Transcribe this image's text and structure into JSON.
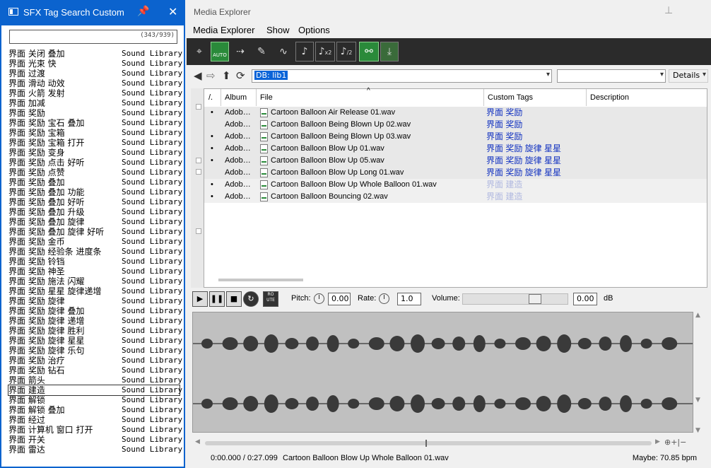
{
  "sfx_window": {
    "title": "SFX Tag Search Custom",
    "pin_glyph": "📌",
    "close_glyph": "✕",
    "count": "(343/939)",
    "rows": [
      {
        "tag": "界面 关闭 叠加",
        "lib": "Sound Library"
      },
      {
        "tag": "界面 光束 快",
        "lib": "Sound Library"
      },
      {
        "tag": "界面 过渡",
        "lib": "Sound Library"
      },
      {
        "tag": "界面 滑动 动效",
        "lib": "Sound Library"
      },
      {
        "tag": "界面 火箭 发射",
        "lib": "Sound Library"
      },
      {
        "tag": "界面 加减",
        "lib": "Sound Library"
      },
      {
        "tag": "界面 奖励",
        "lib": "Sound Library"
      },
      {
        "tag": "界面 奖励 宝石 叠加",
        "lib": "Sound Library"
      },
      {
        "tag": "界面 奖励 宝箱",
        "lib": "Sound Library"
      },
      {
        "tag": "界面 奖励 宝箱 打开",
        "lib": "Sound Library"
      },
      {
        "tag": "界面 奖励 变身",
        "lib": "Sound Library"
      },
      {
        "tag": "界面 奖励 点击 好听",
        "lib": "Sound Library"
      },
      {
        "tag": "界面 奖励 点赞",
        "lib": "Sound Library"
      },
      {
        "tag": "界面 奖励 叠加",
        "lib": "Sound Library"
      },
      {
        "tag": "界面 奖励 叠加 功能",
        "lib": "Sound Library"
      },
      {
        "tag": "界面 奖励 叠加 好听",
        "lib": "Sound Library"
      },
      {
        "tag": "界面 奖励 叠加 升级",
        "lib": "Sound Library"
      },
      {
        "tag": "界面 奖励 叠加 旋律",
        "lib": "Sound Library"
      },
      {
        "tag": "界面 奖励 叠加 旋律 好听",
        "lib": "Sound Library"
      },
      {
        "tag": "界面 奖励 金币",
        "lib": "Sound Library"
      },
      {
        "tag": "界面 奖励 经验条 进度条",
        "lib": "Sound Library"
      },
      {
        "tag": "界面 奖励 铃铛",
        "lib": "Sound Library"
      },
      {
        "tag": "界面 奖励 神圣",
        "lib": "Sound Library"
      },
      {
        "tag": "界面 奖励 施法 闪耀",
        "lib": "Sound Library"
      },
      {
        "tag": "界面 奖励 星星 旋律递增",
        "lib": "Sound Library"
      },
      {
        "tag": "界面 奖励 旋律",
        "lib": "Sound Library"
      },
      {
        "tag": "界面 奖励 旋律 叠加",
        "lib": "Sound Library"
      },
      {
        "tag": "界面 奖励 旋律 递增",
        "lib": "Sound Library"
      },
      {
        "tag": "界面 奖励 旋律 胜利",
        "lib": "Sound Library"
      },
      {
        "tag": "界面 奖励 旋律 星星",
        "lib": "Sound Library"
      },
      {
        "tag": "界面 奖励 旋律 乐句",
        "lib": "Sound Library"
      },
      {
        "tag": "界面 奖励 治疗",
        "lib": "Sound Library"
      },
      {
        "tag": "界面 奖励 钻石",
        "lib": "Sound Library"
      },
      {
        "tag": "界面 箭头",
        "lib": "Sound Library"
      },
      {
        "tag": "界面 建造",
        "lib": "Sound Library",
        "selected": true
      },
      {
        "tag": "界面 解锁",
        "lib": "Sound Library"
      },
      {
        "tag": "界面 解锁 叠加",
        "lib": "Sound Library"
      },
      {
        "tag": "界面 经过",
        "lib": "Sound Library"
      },
      {
        "tag": "界面 计算机 窗口 打开",
        "lib": "Sound Library"
      },
      {
        "tag": "界面 开关",
        "lib": "Sound Library"
      },
      {
        "tag": "界面 雷达",
        "lib": "Sound Library"
      }
    ]
  },
  "media_explorer": {
    "title": "Media Explorer",
    "menu": [
      "Media Explorer",
      "Show",
      "Options"
    ],
    "toolbar": {
      "auto_label": "AUTO",
      "pitch_x2": "x2",
      "pitch_div2": "/2"
    },
    "nav": {
      "db_value": "DB: lib1",
      "second_combo": "",
      "view_value": "Details"
    },
    "columns": [
      "/.",
      "Album",
      "File",
      "Custom Tags",
      "Description"
    ],
    "rows": [
      {
        "dot": "•",
        "album": "Adob…",
        "file": "Cartoon Balloon Air Release 01.wav",
        "tags": "界面 奖励",
        "dim": false
      },
      {
        "dot": "",
        "album": "Adob…",
        "file": "Cartoon Balloon Being Blown Up 02.wav",
        "tags": "界面 奖励",
        "dim": false
      },
      {
        "dot": "•",
        "album": "Adob…",
        "file": "Cartoon Balloon Being Blown Up 03.wav",
        "tags": "界面 奖励",
        "dim": false
      },
      {
        "dot": "•",
        "album": "Adob…",
        "file": "Cartoon Balloon Blow Up 01.wav",
        "tags": "界面 奖励 旋律 星星",
        "dim": false
      },
      {
        "dot": "•",
        "album": "Adob…",
        "file": "Cartoon Balloon Blow Up 05.wav",
        "tags": "界面 奖励 旋律 星星",
        "dim": false
      },
      {
        "dot": "",
        "album": "Adob…",
        "file": "Cartoon Balloon Blow Up Long 01.wav",
        "tags": "界面 奖励 旋律 星星",
        "dim": false
      },
      {
        "dot": "•",
        "album": "Adob…",
        "file": "Cartoon Balloon Blow Up Whole Balloon 01.wav",
        "tags": "界面 建造",
        "dim": true
      },
      {
        "dot": "•",
        "album": "Adob…",
        "file": "Cartoon Balloon Bouncing 02.wav",
        "tags": "界面 建造",
        "dim": true
      }
    ],
    "transport": {
      "route_label": "RO UTE",
      "pitch_label": "Pitch:",
      "pitch_value": "0.00",
      "rate_label": "Rate:",
      "rate_value": "1.0",
      "volume_label": "Volume:",
      "volume_value": "0.00",
      "volume_unit": "dB"
    },
    "status": {
      "time": "0:00.000 / 0:27.099",
      "file": "Cartoon Balloon Blow Up Whole Balloon 01.wav",
      "bpm": "Maybe: 70.85 bpm"
    },
    "colors": {
      "tag_blue": "#1030c0",
      "tag_dim": "#b0b8e0",
      "accent": "#0b63ce",
      "toolbar_bg": "#2b2b2b"
    }
  }
}
